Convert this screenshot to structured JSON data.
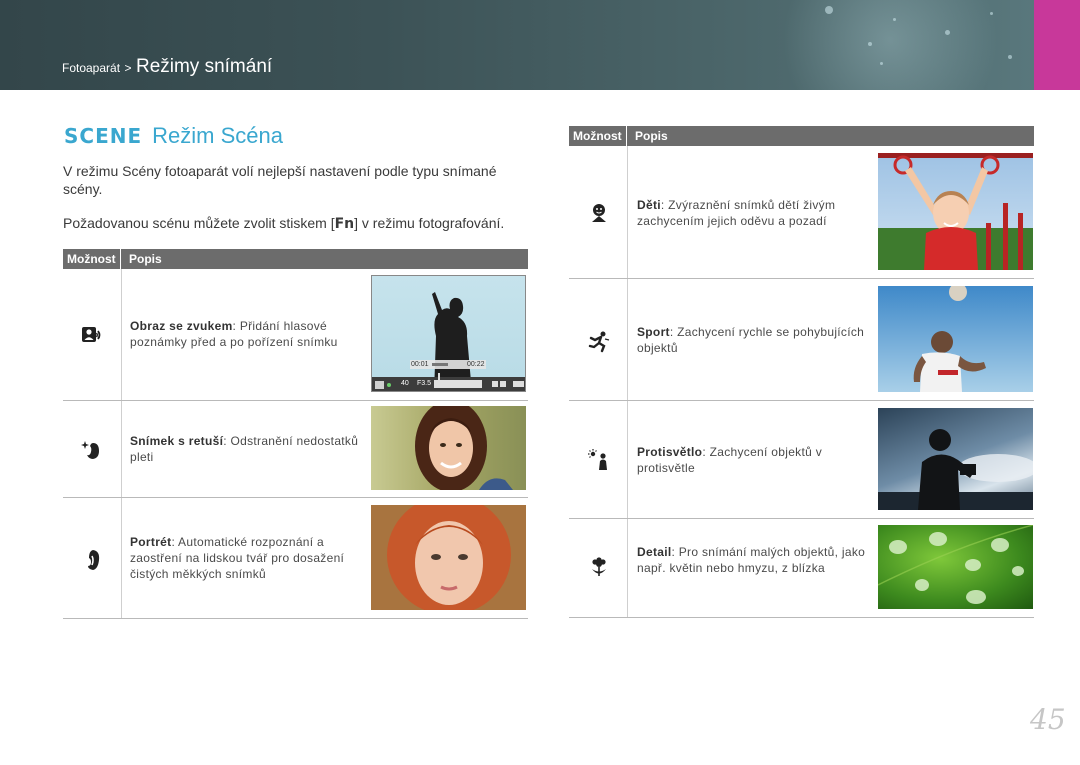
{
  "header": {
    "breadcrumb_parent": "Fotoaparát",
    "breadcrumb_sep": ">",
    "breadcrumb_current": "Režimy snímání"
  },
  "title": {
    "scene_label": "SCENE",
    "text": "Režim Scéna"
  },
  "intro": {
    "p1": "V režimu Scény fotoaparát volí nejlepší nastavení podle typu snímané scény.",
    "p2_before": "Požadovanou scénu můžete zvolit stiskem [",
    "p2_key": "Fn",
    "p2_after": "] v režimu fotografování."
  },
  "table": {
    "col_option": "Možnost",
    "col_description": "Popis"
  },
  "left_rows": [
    {
      "icon": "voice-memo-icon",
      "name": "Obraz se zvukem",
      "text": ": Přidání hlasové poznámky před a po pořízení snímku"
    },
    {
      "icon": "beauty-shot-icon",
      "name": "Snímek s retuší",
      "text": ": Odstranění nedostatků pleti"
    },
    {
      "icon": "portrait-icon",
      "name": "Portrét",
      "text": ": Automatické rozpoznání a zaostření na lidskou tvář pro dosažení čistých měkkých snímků"
    }
  ],
  "right_rows": [
    {
      "icon": "children-icon",
      "name": "Děti",
      "text": ": Zvýraznění snímků dětí živým zachycením jejich oděvu a pozadí"
    },
    {
      "icon": "sports-icon",
      "name": "Sport",
      "text": ": Zachycení rychle se pohybujících objektů"
    },
    {
      "icon": "backlight-icon",
      "name": "Protisvětlo",
      "text": ": Zachycení objektů v protisvětle"
    },
    {
      "icon": "macro-flower-icon",
      "name": "Detail",
      "text": ": Pro snímání malých objektů, jako např. květin nebo hmyzu, z blízka"
    }
  ],
  "lcd": {
    "time_start": "00:01",
    "time_end": "00:22",
    "shutter": "40",
    "aperture": "F3.5"
  },
  "colors": {
    "accent": "#3aa7cf",
    "header_bg": "#3c5256",
    "tab": "#c8389a",
    "table_header": "#6c6c6c"
  },
  "page_number": "45"
}
